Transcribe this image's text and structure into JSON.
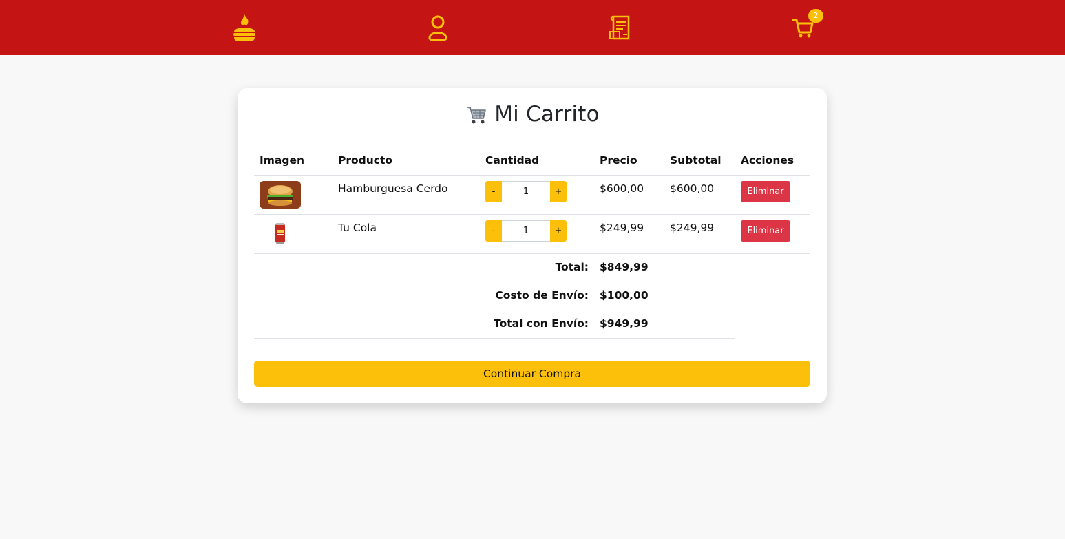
{
  "navbar": {
    "menu_icon": "burger-flame-icon",
    "user_icon": "user-icon",
    "orders_icon": "receipt-icon",
    "cart_icon": "cart-icon",
    "cart_count": "2",
    "color_bg": "#c41414",
    "color_accent": "#fcc00a"
  },
  "cart": {
    "title": "Mi Carrito",
    "title_icon": "shopping-cart-icon",
    "columns": [
      "Imagen",
      "Producto",
      "Cantidad",
      "Precio",
      "Subtotal",
      "Acciones"
    ],
    "items": [
      {
        "name": "Hamburguesa Cerdo",
        "qty": "1",
        "minus": "-",
        "plus": "+",
        "price": "$600,00",
        "subtotal": "$600,00",
        "action": "Eliminar",
        "image_icon": "burger-photo"
      },
      {
        "name": "Tu Cola",
        "qty": "1",
        "minus": "-",
        "plus": "+",
        "price": "$249,99",
        "subtotal": "$249,99",
        "action": "Eliminar",
        "image_icon": "cola-can-photo"
      }
    ],
    "totals": {
      "total_label": "Total:",
      "total_value": "$849,99",
      "shipping_label": "Costo de Envío:",
      "shipping_value": "$100,00",
      "grand_label": "Total con Envío:",
      "grand_value": "$949,99"
    },
    "continue_label": "Continuar Compra"
  }
}
